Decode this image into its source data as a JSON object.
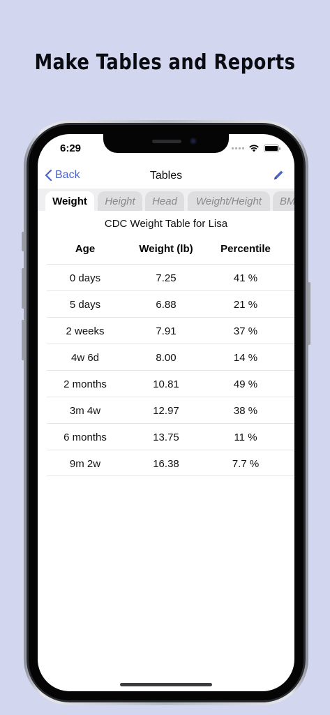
{
  "promo": {
    "headline": "Make Tables and Reports"
  },
  "status_bar": {
    "time": "6:29"
  },
  "navbar": {
    "back_label": "Back",
    "title": "Tables"
  },
  "tabs": [
    {
      "label": "Weight",
      "active": true
    },
    {
      "label": "Height",
      "active": false
    },
    {
      "label": "Head",
      "active": false
    },
    {
      "label": "Weight/Height",
      "active": false
    },
    {
      "label": "BMI",
      "active": false
    }
  ],
  "table": {
    "title": "CDC Weight Table for Lisa",
    "headers": [
      "Age",
      "Weight (lb)",
      "Percentile"
    ],
    "rows": [
      [
        "0 days",
        "7.25",
        "41 %"
      ],
      [
        "5 days",
        "6.88",
        "21 %"
      ],
      [
        "2 weeks",
        "7.91",
        "37 %"
      ],
      [
        "4w 6d",
        "8.00",
        "14 %"
      ],
      [
        "2 months",
        "10.81",
        "49 %"
      ],
      [
        "3m 4w",
        "12.97",
        "38 %"
      ],
      [
        "6 months",
        "13.75",
        "11 %"
      ],
      [
        "9m 2w",
        "16.38",
        "7.7 %"
      ]
    ]
  },
  "colors": {
    "background": "#d2d6ee",
    "accent": "#4a63c8"
  },
  "icons": [
    "chevron-left-icon",
    "pencil-icon",
    "wifi-icon",
    "battery-icon",
    "signal-icon"
  ]
}
